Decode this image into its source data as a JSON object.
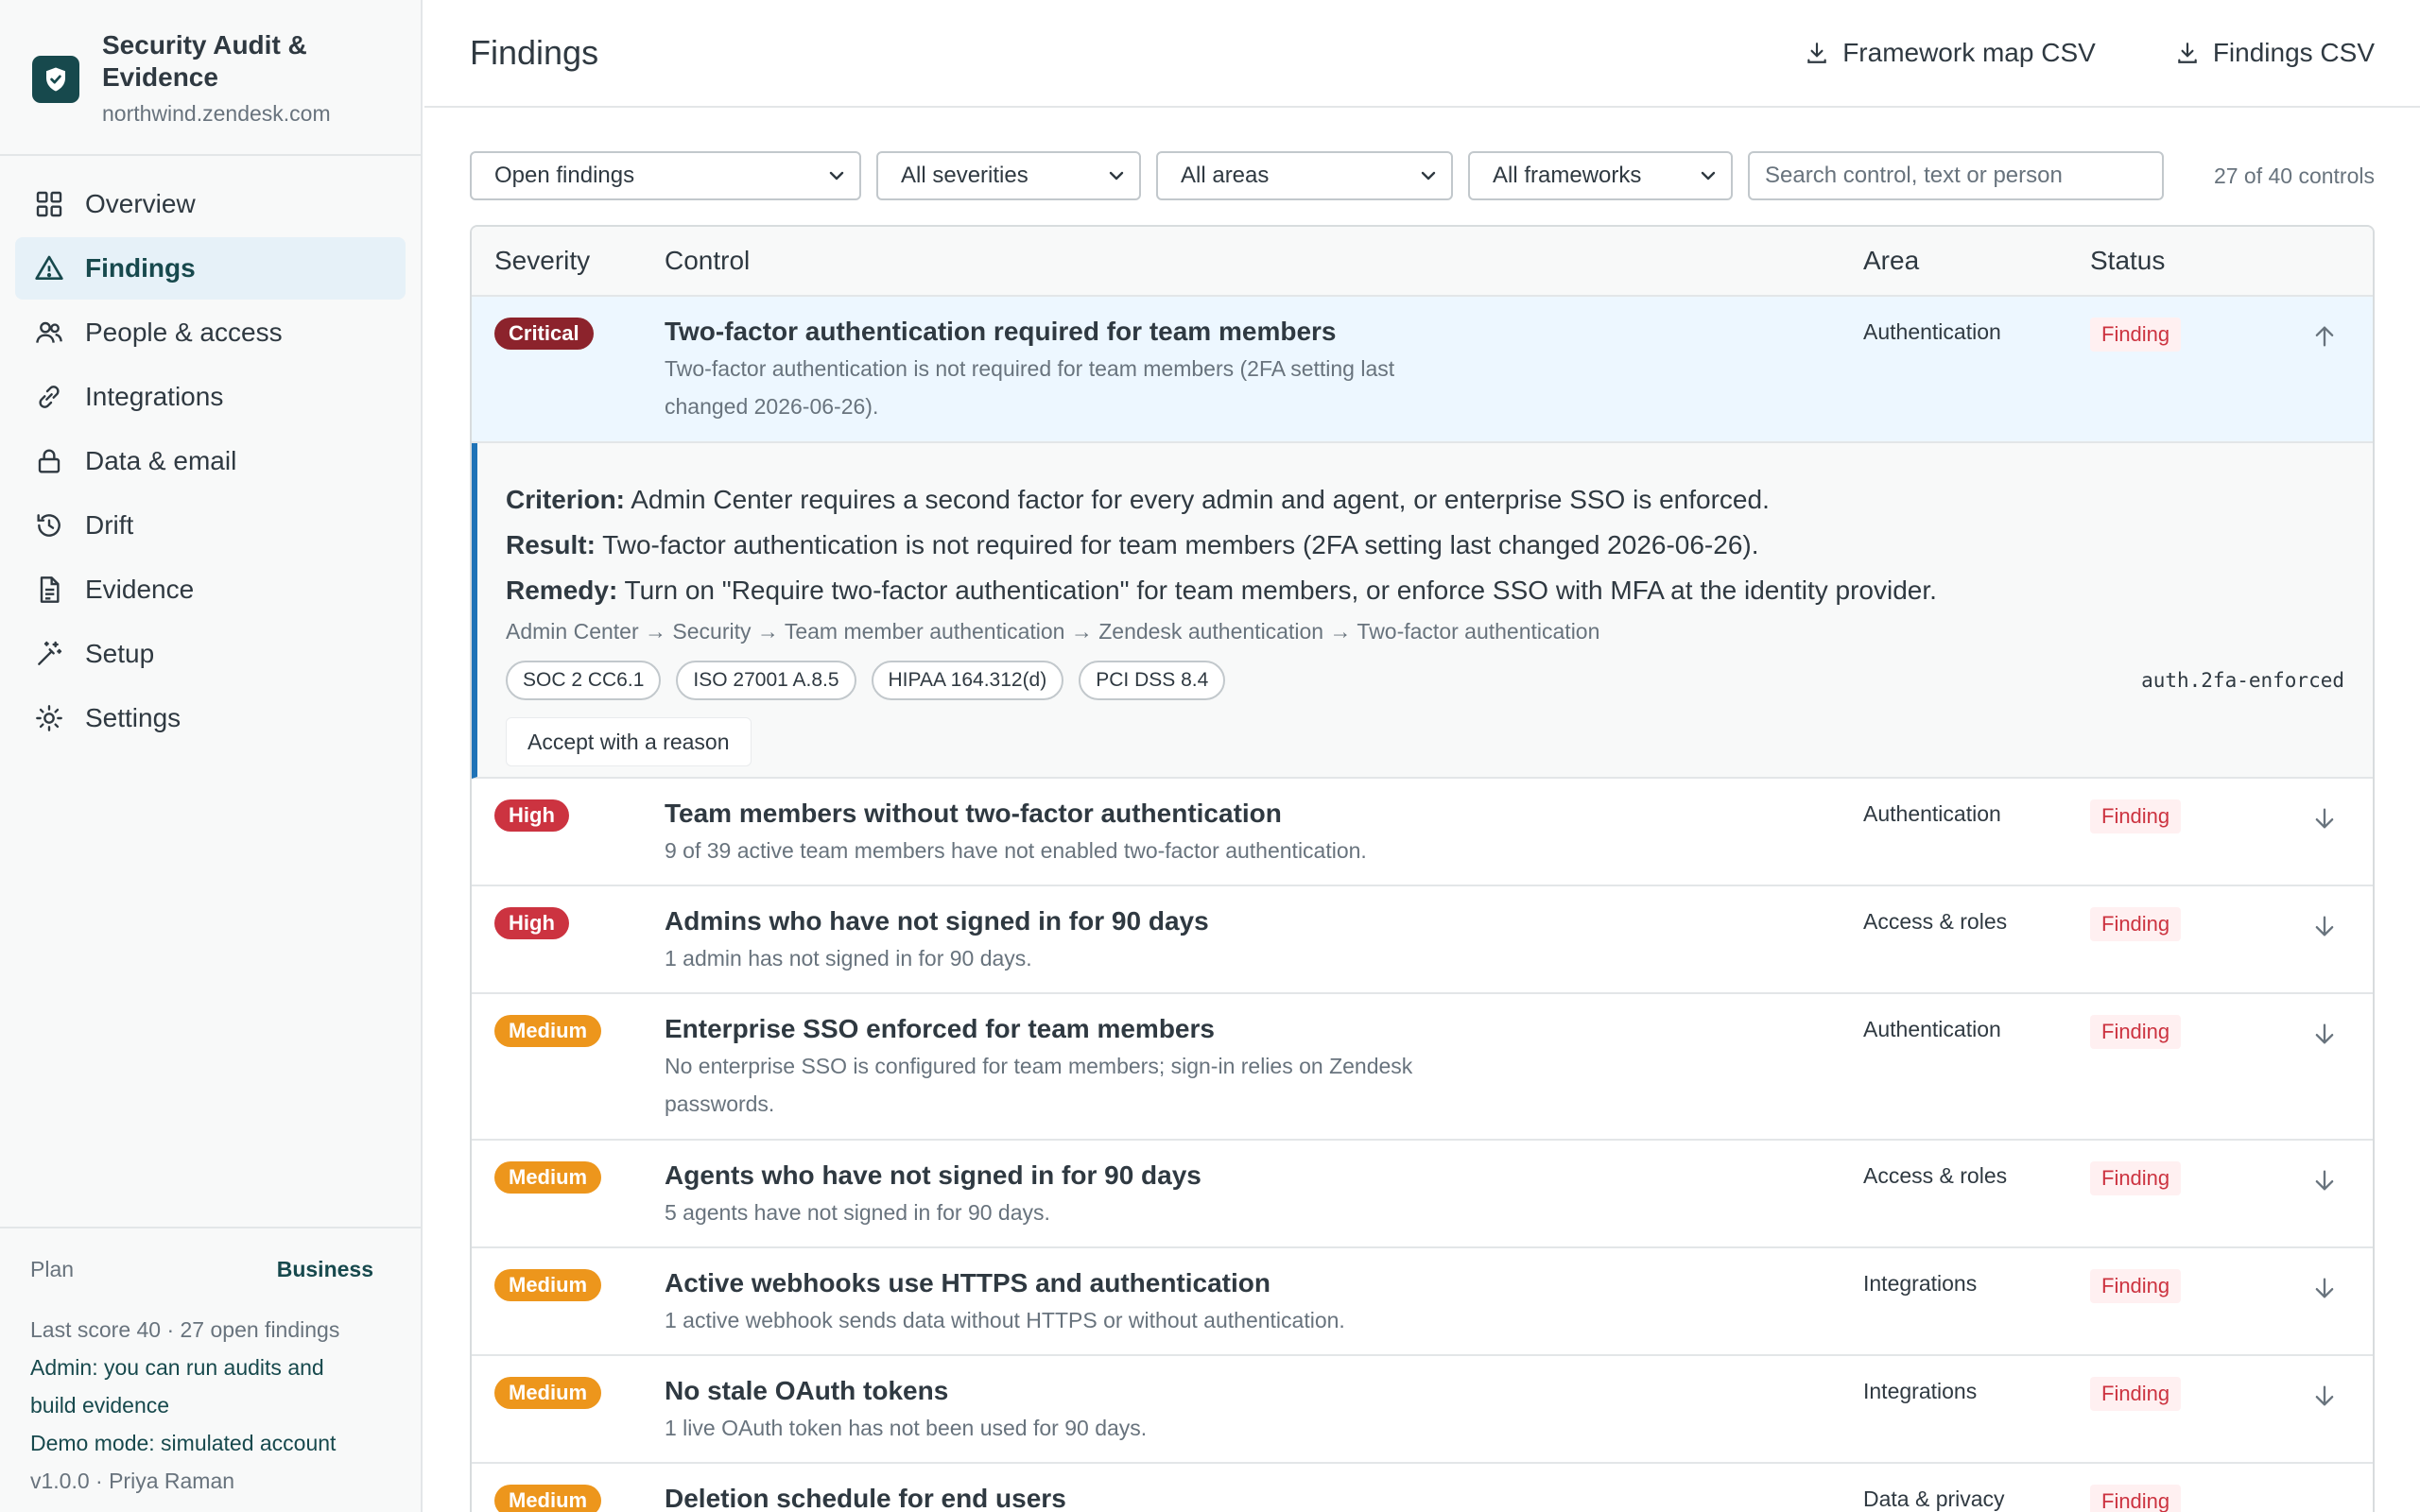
{
  "app": {
    "title": "Security Audit & Evidence",
    "subdomain": "northwind.zendesk.com"
  },
  "sidebar": {
    "items": [
      {
        "label": "Overview",
        "icon": "grid-icon",
        "active": false
      },
      {
        "label": "Findings",
        "icon": "warning-triangle-icon",
        "active": true
      },
      {
        "label": "People & access",
        "icon": "people-icon",
        "active": false
      },
      {
        "label": "Integrations",
        "icon": "link-icon",
        "active": false
      },
      {
        "label": "Data & email",
        "icon": "lock-icon",
        "active": false
      },
      {
        "label": "Drift",
        "icon": "history-icon",
        "active": false
      },
      {
        "label": "Evidence",
        "icon": "document-icon",
        "active": false
      },
      {
        "label": "Setup",
        "icon": "magic-wand-icon",
        "active": false
      },
      {
        "label": "Settings",
        "icon": "gear-icon",
        "active": false
      }
    ],
    "footer": {
      "plan_label": "Plan",
      "plan_value": "Business",
      "score": "Last score 40 · 27 open findings",
      "admin_note_1": "Admin: you can run audits and",
      "admin_note_2": "build evidence",
      "demo": "Demo mode: simulated account",
      "version": "v1.0.0 · Priya Raman"
    }
  },
  "header": {
    "title": "Findings",
    "framework_csv": "Framework map CSV",
    "findings_csv": "Findings CSV"
  },
  "filters": {
    "status": "Open findings",
    "severity": "All severities",
    "area": "All areas",
    "framework": "All frameworks",
    "search_placeholder": "Search control, text or person",
    "count": "27 of 40 controls"
  },
  "table": {
    "columns": {
      "severity": "Severity",
      "control": "Control",
      "area": "Area",
      "status": "Status"
    },
    "expanded": {
      "severity": "Critical",
      "title": "Two-factor authentication required for team members",
      "desc_1": "Two-factor authentication is not required for team members (2FA setting last",
      "desc_2": "changed 2026-06-26).",
      "area": "Authentication",
      "status": "Finding",
      "criterion_label": "Criterion:",
      "criterion": " Admin Center requires a second factor for every admin and agent, or enterprise SSO is enforced.",
      "result_label": "Result:",
      "result": " Two-factor authentication is not required for team members (2FA setting last changed 2026-06-26).",
      "remedy_label": "Remedy:",
      "remedy": " Turn on \"Require two-factor authentication\" for team members, or enforce SSO with MFA at the identity provider.",
      "path": "Admin Center → Security → Team member authentication → Zendesk authentication → Two-factor authentication",
      "frameworks": [
        "SOC 2 CC6.1",
        "ISO 27001 A.8.5",
        "HIPAA 164.312(d)",
        "PCI DSS 8.4"
      ],
      "control_id": "auth.2fa-enforced",
      "accept_label": "Accept with a reason"
    },
    "rows": [
      {
        "severity": "High",
        "title": "Team members without two-factor authentication",
        "desc_1": "9 of 39 active team members have not enabled two-factor authentication.",
        "desc_2": "",
        "area": "Authentication",
        "status": "Finding"
      },
      {
        "severity": "High",
        "title": "Admins who have not signed in for 90 days",
        "desc_1": "1 admin has not signed in for 90 days.",
        "desc_2": "",
        "area": "Access & roles",
        "status": "Finding"
      },
      {
        "severity": "Medium",
        "title": "Enterprise SSO enforced for team members",
        "desc_1": "No enterprise SSO is configured for team members; sign-in relies on Zendesk",
        "desc_2": "passwords.",
        "area": "Authentication",
        "status": "Finding"
      },
      {
        "severity": "Medium",
        "title": "Agents who have not signed in for 90 days",
        "desc_1": "5 agents have not signed in for 90 days.",
        "desc_2": "",
        "area": "Access & roles",
        "status": "Finding"
      },
      {
        "severity": "Medium",
        "title": "Active webhooks use HTTPS and authentication",
        "desc_1": "1 active webhook sends data without HTTPS or without authentication.",
        "desc_2": "",
        "area": "Integrations",
        "status": "Finding"
      },
      {
        "severity": "Medium",
        "title": "No stale OAuth tokens",
        "desc_1": "1 live OAuth token has not been used for 90 days.",
        "desc_2": "",
        "area": "Integrations",
        "status": "Finding"
      },
      {
        "severity": "Medium",
        "title": "Deletion schedule for end users",
        "desc_1": "",
        "desc_2": "",
        "area": "Data & privacy",
        "status": "Finding"
      }
    ]
  },
  "colors": {
    "critical": "#8c232c",
    "high": "#cc3340",
    "medium": "#ed961c",
    "accent": "#1f73b7",
    "brand": "#17494d"
  }
}
